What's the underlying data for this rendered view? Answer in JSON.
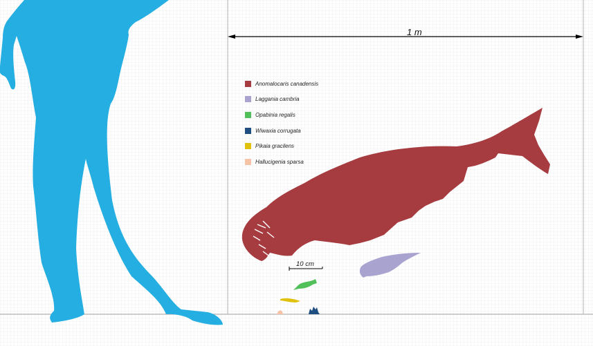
{
  "scale_bars": {
    "large": "1 m",
    "small": "10 cm"
  },
  "legend": [
    {
      "label": "Anomalocaris canadensis",
      "color": "#a73c40"
    },
    {
      "label": "Laggania cambria",
      "color": "#a9a3cf"
    },
    {
      "label": "Opabinia regalis",
      "color": "#52c05a"
    },
    {
      "label": "Wiwaxia corrugata",
      "color": "#1f4f82"
    },
    {
      "label": "Pikaia gracilens",
      "color": "#e0c20e"
    },
    {
      "label": "Hallucigenia sparsa",
      "color": "#f6c3a6"
    }
  ],
  "colors": {
    "human_silhouette": "#25aee2",
    "grid_line": "#e6e6e6",
    "scale_bar": "#000000"
  }
}
